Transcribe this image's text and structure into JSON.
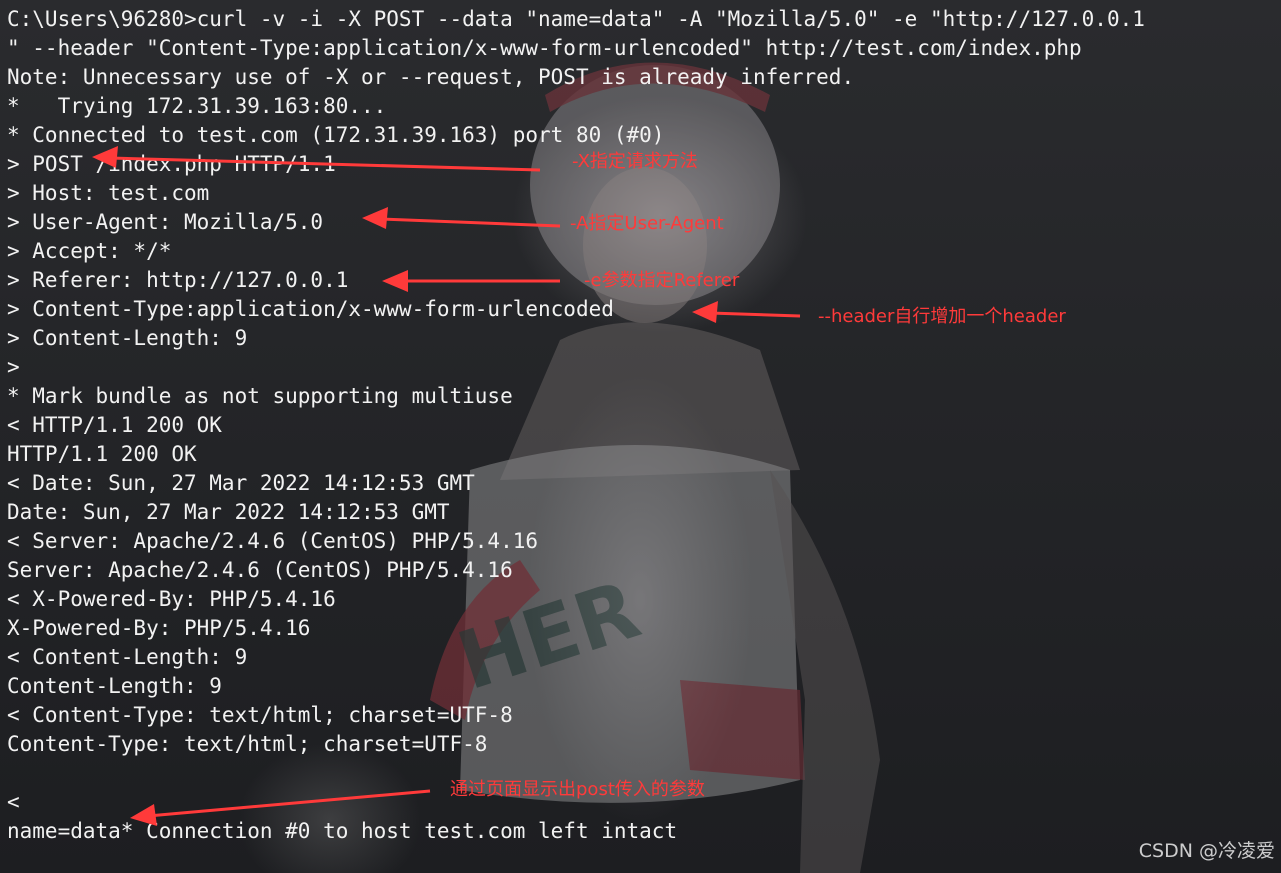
{
  "terminal": {
    "lines": [
      "C:\\Users\\96280>curl -v -i -X POST --data \"name=data\" -A \"Mozilla/5.0\" -e \"http://127.0.0.1",
      "\" --header \"Content-Type:application/x-www-form-urlencoded\" http://test.com/index.php",
      "Note: Unnecessary use of -X or --request, POST is already inferred.",
      "*   Trying 172.31.39.163:80...",
      "* Connected to test.com (172.31.39.163) port 80 (#0)",
      "> POST /index.php HTTP/1.1",
      "> Host: test.com",
      "> User-Agent: Mozilla/5.0",
      "> Accept: */*",
      "> Referer: http://127.0.0.1",
      "> Content-Type:application/x-www-form-urlencoded",
      "> Content-Length: 9",
      ">",
      "* Mark bundle as not supporting multiuse",
      "< HTTP/1.1 200 OK",
      "HTTP/1.1 200 OK",
      "< Date: Sun, 27 Mar 2022 14:12:53 GMT",
      "Date: Sun, 27 Mar 2022 14:12:53 GMT",
      "< Server: Apache/2.4.6 (CentOS) PHP/5.4.16",
      "Server: Apache/2.4.6 (CentOS) PHP/5.4.16",
      "< X-Powered-By: PHP/5.4.16",
      "X-Powered-By: PHP/5.4.16",
      "< Content-Length: 9",
      "Content-Length: 9",
      "< Content-Type: text/html; charset=UTF-8",
      "Content-Type: text/html; charset=UTF-8",
      "",
      "<",
      "name=data* Connection #0 to host test.com left intact"
    ]
  },
  "annotations": {
    "color": "#ff3a3a",
    "x_method": "-X指定请求方法",
    "a_user_agent": "-A指定User-Agent",
    "e_referer": "-e参数指定Referer",
    "header_added": "--header自行增加一个header",
    "post_params_shown": "通过页面显示出post传入的参数"
  },
  "watermark": "CSDN @冷凌爱"
}
